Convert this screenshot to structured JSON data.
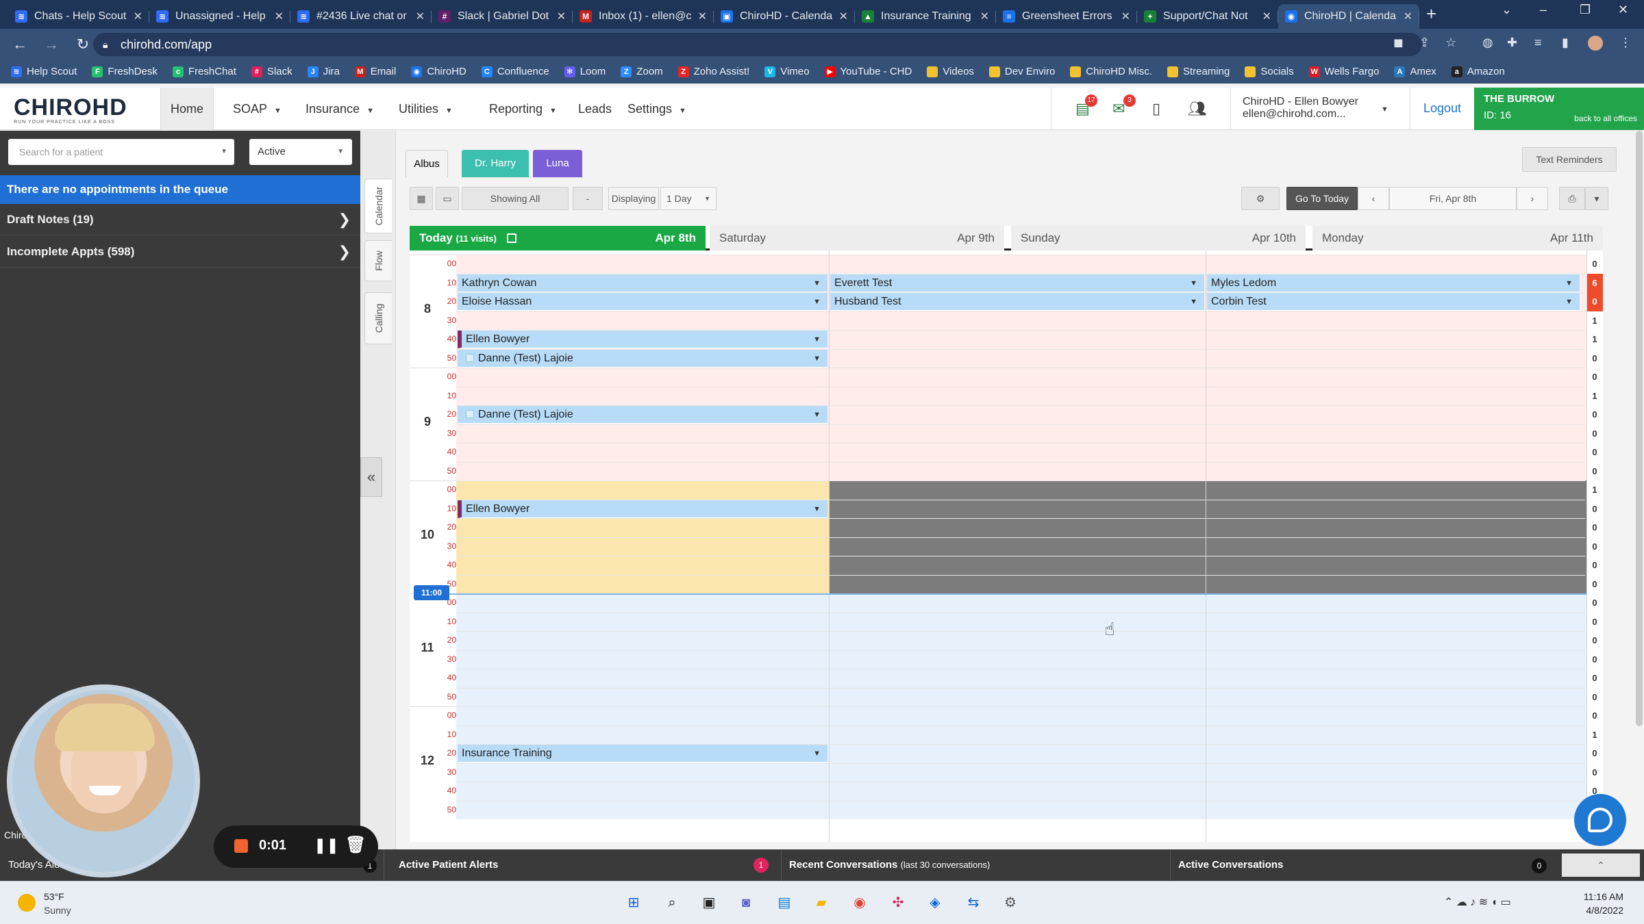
{
  "browser": {
    "tabs": [
      {
        "title": "Chats - Help Scout",
        "icon_color": "#2f6cf6",
        "icon": "≋"
      },
      {
        "title": "Unassigned - Help",
        "icon_color": "#2f6cf6",
        "icon": "≋"
      },
      {
        "title": "#2436 Live chat or",
        "icon_color": "#2f6cf6",
        "icon": "≋"
      },
      {
        "title": "Slack | Gabriel Dot",
        "icon_color": "#611f69",
        "icon": "#"
      },
      {
        "title": "Inbox (1) - ellen@c",
        "icon_color": "#c5221f",
        "icon": "M"
      },
      {
        "title": "ChiroHD - Calenda",
        "icon_color": "#1a73e8",
        "icon": "▣"
      },
      {
        "title": "Insurance Training",
        "icon_color": "#188038",
        "icon": "▲"
      },
      {
        "title": "Greensheet Errors",
        "icon_color": "#1a73e8",
        "icon": "≡"
      },
      {
        "title": "Support/Chat Not",
        "icon_color": "#188038",
        "icon": "+"
      },
      {
        "title": "ChiroHD | Calenda",
        "icon_color": "#1a73e8",
        "icon": "◉"
      }
    ],
    "url": "chirohd.com/app",
    "bookmarks": [
      {
        "label": "Help Scout",
        "color": "#2f6cf6",
        "icon": "≋"
      },
      {
        "label": "FreshDesk",
        "color": "#25c16f",
        "icon": "F"
      },
      {
        "label": "FreshChat",
        "color": "#25c16f",
        "icon": "c"
      },
      {
        "label": "Slack",
        "color": "#e01e5a",
        "icon": "#"
      },
      {
        "label": "Jira",
        "color": "#2684ff",
        "icon": "J"
      },
      {
        "label": "Email",
        "color": "#c5221f",
        "icon": "M"
      },
      {
        "label": "ChiroHD",
        "color": "#1a73e8",
        "icon": "◉"
      },
      {
        "label": "Confluence",
        "color": "#2684ff",
        "icon": "C"
      },
      {
        "label": "Loom",
        "color": "#625df5",
        "icon": "✻"
      },
      {
        "label": "Zoom",
        "color": "#2d8cff",
        "icon": "Z"
      },
      {
        "label": "Zoho Assist!",
        "color": "#e42527",
        "icon": "Z"
      },
      {
        "label": "Vimeo",
        "color": "#1ab7ea",
        "icon": "V"
      },
      {
        "label": "YouTube - CHD",
        "color": "#ff0000",
        "icon": "▶"
      },
      {
        "label": "Videos",
        "color": "#f2c230",
        "icon": ""
      },
      {
        "label": "Dev Enviro",
        "color": "#f2c230",
        "icon": ""
      },
      {
        "label": "ChiroHD Misc.",
        "color": "#f2c230",
        "icon": ""
      },
      {
        "label": "Streaming",
        "color": "#f2c230",
        "icon": ""
      },
      {
        "label": "Socials",
        "color": "#f2c230",
        "icon": ""
      },
      {
        "label": "Wells Fargo",
        "color": "#d71e28",
        "icon": "W"
      },
      {
        "label": "Amex",
        "color": "#2e77bb",
        "icon": "A"
      },
      {
        "label": "Amazon",
        "color": "#222222",
        "icon": "a"
      }
    ]
  },
  "app": {
    "logo_text": "CHIROHD",
    "logo_tagline": "RUN YOUR PRACTICE LIKE A BOSS",
    "nav": [
      "Home",
      "SOAP",
      "Insurance",
      "Utilities",
      "Reporting",
      "Leads",
      "Settings"
    ],
    "badge_messages": "17",
    "badge_mail": "3",
    "user_name": "ChiroHD - Ellen Bowyer",
    "user_email": "ellen@chirohd.com...",
    "logout": "Logout",
    "office_name": "THE BURROW",
    "office_id": "ID: 16",
    "office_back": "back to all offices"
  },
  "left": {
    "search_placeholder": "Search for a patient",
    "status": "Active",
    "queue": "There are no appointments in the queue",
    "draft_notes": "Draft Notes (19)",
    "incomplete": "Incomplete Appts (598)",
    "side_tabs": [
      "Calendar",
      "Flow",
      "Calling"
    ]
  },
  "calendar": {
    "providers": [
      {
        "label": "Albus",
        "bg": "#ffffff",
        "fg": "#333333"
      },
      {
        "label": "Dr. Harry",
        "bg": "#3dbfb0",
        "fg": "#ffffff"
      },
      {
        "label": "Luna",
        "bg": "#7b5fd6",
        "fg": "#ffffff"
      }
    ],
    "text_reminders": "Text Reminders",
    "showing_all": "Showing All",
    "minus": "-",
    "displaying": "Displaying",
    "span": "1 Day",
    "go_today": "Go To Today",
    "date": "Fri, Apr 8th",
    "today_label": "Today",
    "today_visits": "(11 visits)",
    "today_date": "Apr 8th",
    "days": [
      {
        "name": "Saturday",
        "date": "Apr 9th"
      },
      {
        "name": "Sunday",
        "date": "Apr 10th"
      },
      {
        "name": "Monday",
        "date": "Apr 11th"
      }
    ],
    "hours": [
      "8",
      "9",
      "10",
      "11",
      "12"
    ],
    "minutes": [
      "00",
      "10",
      "20",
      "30",
      "40",
      "50"
    ],
    "current_time": "11:00",
    "counts": [
      "0",
      "6",
      "0",
      "1",
      "1",
      "0",
      "0",
      "1",
      "0",
      "0",
      "0",
      "0",
      "1",
      "0",
      "0",
      "0",
      "0",
      "0",
      "0",
      "0",
      "0",
      "0",
      "0",
      "0",
      "0",
      "1",
      "0",
      "0",
      "0",
      "0"
    ],
    "appointments": [
      {
        "name": "Kathryn Cowan",
        "col": 0,
        "slot": 1,
        "style": "plain"
      },
      {
        "name": "Eloise Hassan",
        "col": 0,
        "slot": 2,
        "style": "plain"
      },
      {
        "name": "Everett Test",
        "col": 1,
        "slot": 1,
        "style": "plain"
      },
      {
        "name": "Husband Test",
        "col": 1,
        "slot": 2,
        "style": "plain"
      },
      {
        "name": "Myles Ledom",
        "col": 2,
        "slot": 1,
        "style": "plain"
      },
      {
        "name": "Corbin Test",
        "col": 2,
        "slot": 2,
        "style": "plain"
      },
      {
        "name": "Ellen Bowyer",
        "col": 0,
        "slot": 4,
        "style": "bar"
      },
      {
        "name": "Danne (Test) Lajoie",
        "col": 0,
        "slot": 5,
        "style": "sub"
      },
      {
        "name": "Danne (Test) Lajoie",
        "col": 0,
        "slot": 8,
        "style": "sub"
      },
      {
        "name": "Ellen Bowyer",
        "col": 0,
        "slot": 13,
        "style": "bar"
      },
      {
        "name": "Insurance Training",
        "col": 0,
        "slot": 26,
        "style": "plain"
      }
    ]
  },
  "bottom": {
    "todays_alerts": "Today's Alerts",
    "todays_count": "1",
    "active_patient_alerts": "Active Patient Alerts",
    "alert_count": "1",
    "recent_conv": "Recent Conversations",
    "recent_conv_sub": "(last 30 conversations)",
    "active_conv": "Active Conversations",
    "active_conv_count": "0",
    "chat_label": "Chiro"
  },
  "recorder": {
    "time": "0:01"
  },
  "taskbar": {
    "weather_temp": "53°F",
    "weather_text": "Sunny",
    "time": "11:16 AM",
    "date": "4/8/2022"
  }
}
